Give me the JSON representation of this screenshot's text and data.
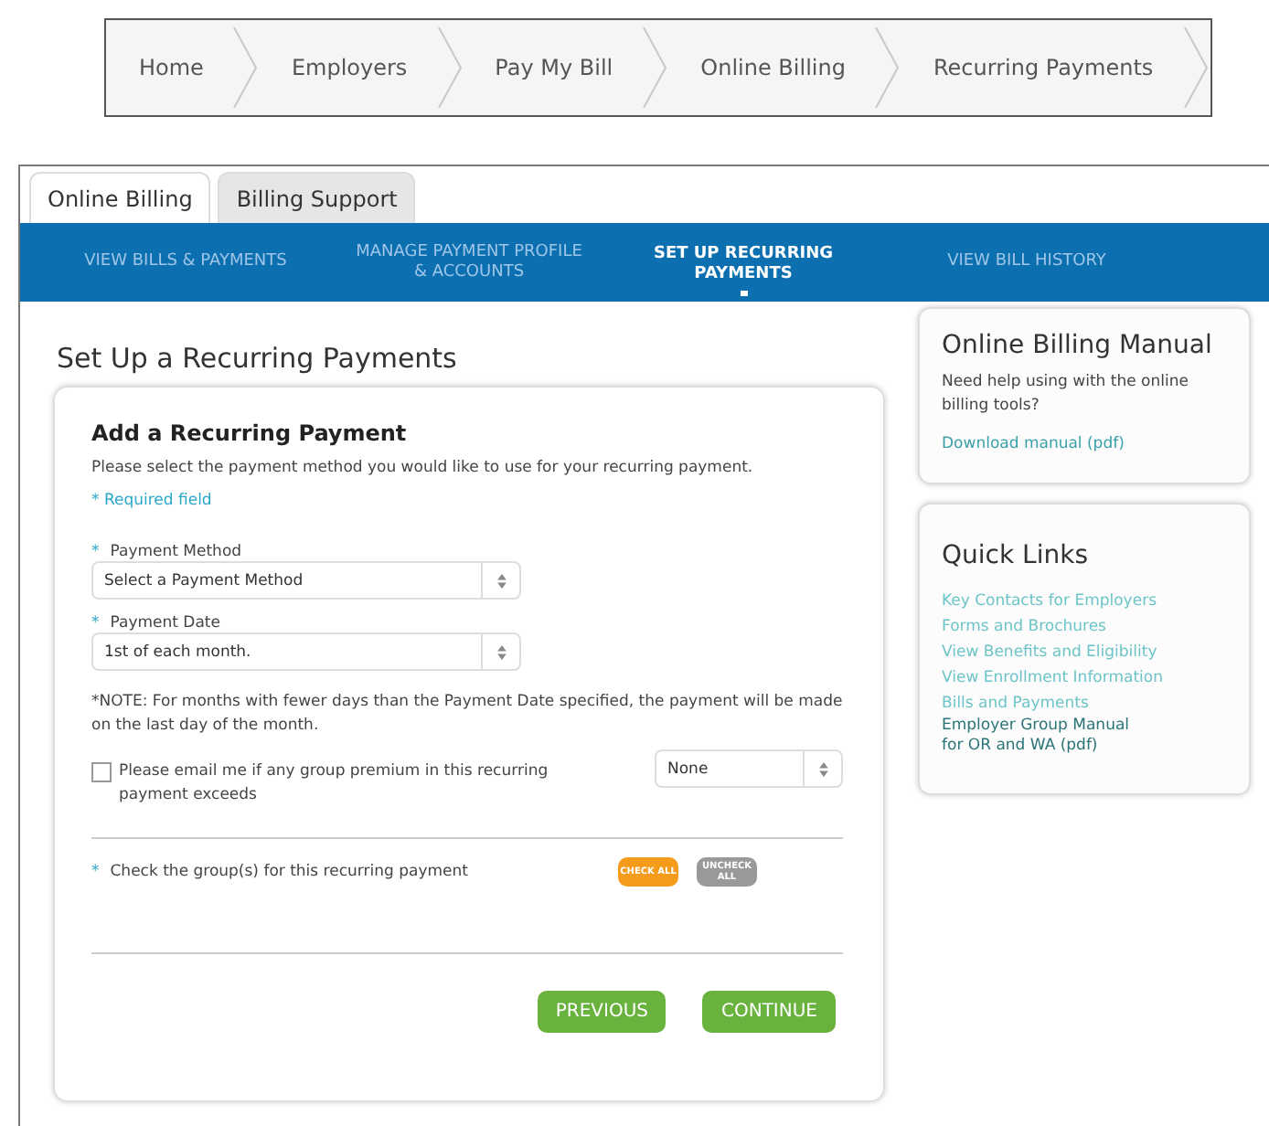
{
  "breadcrumb": [
    "Home",
    "Employers",
    "Pay My Bill",
    "Online Billing",
    "Recurring Payments"
  ],
  "tabs": [
    {
      "label": "Online Billing",
      "selected": true
    },
    {
      "label": "Billing Support",
      "selected": false
    }
  ],
  "nav": [
    {
      "label": "VIEW BILLS & PAYMENTS",
      "selected": false
    },
    {
      "label": "MANAGE PAYMENT PROFILE & ACCOUNTS",
      "selected": false
    },
    {
      "label": "SET UP RECURRING PAYMENTS",
      "selected": true
    },
    {
      "label": "VIEW BILL HISTORY",
      "selected": false
    }
  ],
  "page_title": "Set Up a Recurring Payments",
  "form": {
    "heading": "Add a Recurring Payment",
    "intro": "Please select the payment method you would like to use for your recurring payment.",
    "required_note": "* Required field",
    "required_mark": "*",
    "fields": [
      {
        "label": "Payment Method",
        "value": "Select a Payment Method",
        "required": true
      },
      {
        "label": "Payment Date",
        "value": "1st of each month.",
        "required": true
      }
    ],
    "note": "*NOTE: For months with fewer days than the Payment Date specified, the payment will be made on the last day of the month.",
    "email_option": {
      "label": "Please email me if any group premium in this recurring payment exceeds",
      "checked": false,
      "value": "None"
    },
    "groups_label": "Check the group(s) for this recurring payment",
    "group_buttons": [
      {
        "label": "CHECK ALL",
        "kind": "check"
      },
      {
        "label": "UNCHECK ALL",
        "kind": "uncheck"
      }
    ],
    "buttons": [
      "PREVIOUS",
      "CONTINUE"
    ]
  },
  "manual": {
    "title": "Online Billing Manual",
    "text": "Need help using with the online billing tools?",
    "link": "Download manual (pdf)"
  },
  "quick_links": {
    "title": "Quick Links",
    "links": [
      {
        "label": "Key Contacts for Employers",
        "visited": false
      },
      {
        "label": "Forms and Brochures",
        "visited": false
      },
      {
        "label": "View Benefits and Eligibility",
        "visited": false
      },
      {
        "label": "View Enrollment Information",
        "visited": false
      },
      {
        "label": "Bills and Payments",
        "visited": false
      },
      {
        "label": "Employer Group Manual for OR and WA (pdf)",
        "visited": true
      }
    ]
  }
}
